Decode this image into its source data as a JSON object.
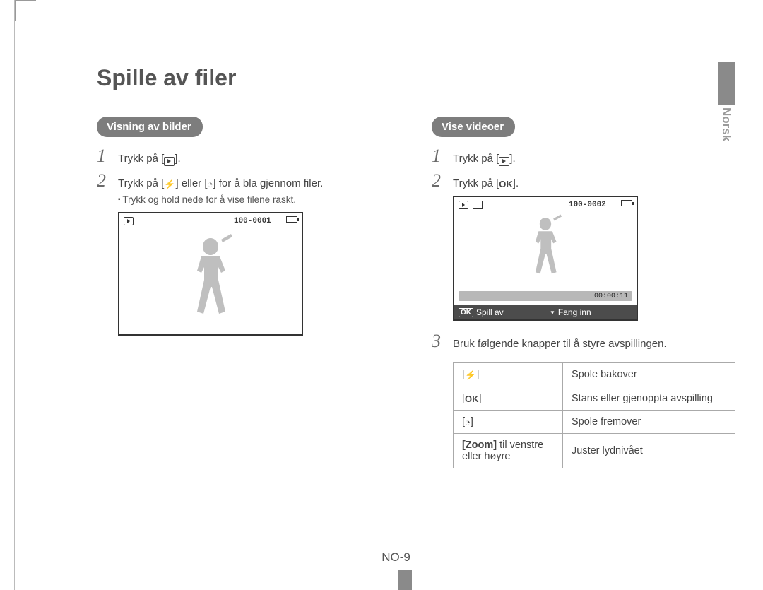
{
  "language_tab": "Norsk",
  "title": "Spille av filer",
  "left": {
    "label": "Visning av bilder",
    "step1": "Trykk på [",
    "step1_tail": "].",
    "step2_a": "Trykk på [",
    "step2_b": "] eller [",
    "step2_c": "] for å bla gjennom filer.",
    "step2_sub": "Trykk og hold nede for å vise filene raskt.",
    "lcd_counter": "100-0001"
  },
  "right": {
    "label": "Vise videoer",
    "step1": "Trykk på [",
    "step1_tail": "].",
    "step2": "Trykk på [",
    "step2_tail": "].",
    "lcd_counter": "100-0002",
    "time": "00:00:11",
    "foot_ok": "OK",
    "foot_play": "Spill av",
    "foot_cap": "Fang inn",
    "step3": "Bruk følgende knapper til å styre avspillingen."
  },
  "table": {
    "r1c2": "Spole bakover",
    "r2c2": "Stans eller gjenoppta avspilling",
    "r3c2": "Spole fremover",
    "r4c1_a": "[Zoom]",
    "r4c1_b": " til venstre eller høyre",
    "r4c2": "Juster lydnivået"
  },
  "icons": {
    "ok": "OK",
    "flash": "⚡",
    "timer": "◔"
  },
  "page_number": "NO-9"
}
